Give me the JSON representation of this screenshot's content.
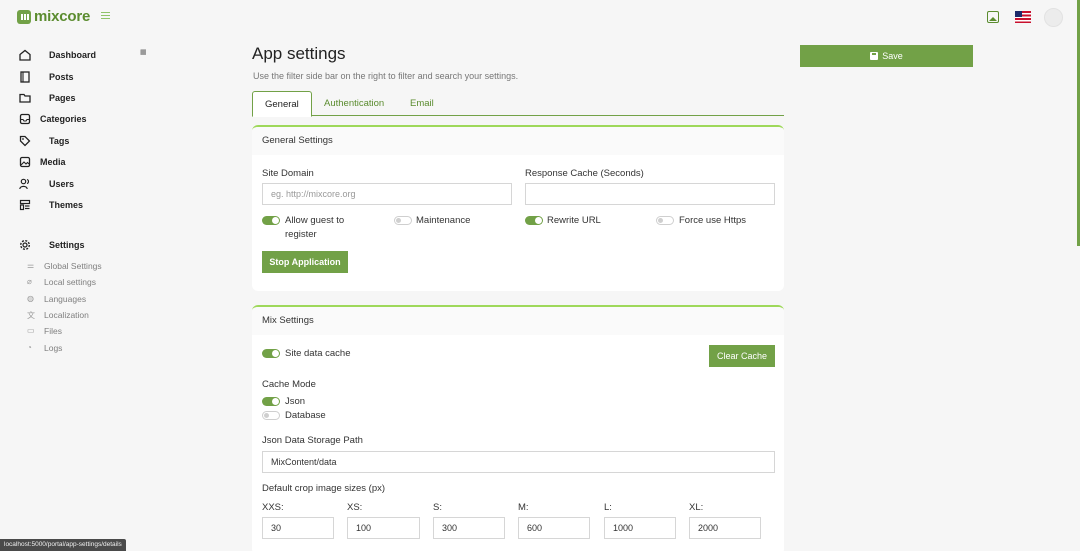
{
  "header": {
    "logo_text": "mixcore",
    "icons": [
      "menu-icon",
      "image-icon",
      "us-flag-icon",
      "avatar"
    ]
  },
  "sidebar": {
    "items": [
      {
        "label": "Dashboard",
        "icon": "home-icon"
      },
      {
        "label": "Posts",
        "icon": "document-icon"
      },
      {
        "label": "Pages",
        "icon": "folder-icon"
      },
      {
        "label": "Categories",
        "icon": "inbox-icon"
      },
      {
        "label": "Tags",
        "icon": "tag-icon"
      },
      {
        "label": "Media",
        "icon": "image-icon"
      },
      {
        "label": "Users",
        "icon": "users-icon"
      },
      {
        "label": "Themes",
        "icon": "layout-icon"
      },
      {
        "label": "Settings",
        "icon": "gear-icon"
      }
    ],
    "settings_sub": [
      {
        "label": "Global Settings",
        "icon": "sliders-icon"
      },
      {
        "label": "Local settings",
        "icon": "link-icon"
      },
      {
        "label": "Languages",
        "icon": "globe-icon"
      },
      {
        "label": "Localization",
        "icon": "translate-icon"
      },
      {
        "label": "Files",
        "icon": "file-icon"
      },
      {
        "label": "Logs",
        "icon": "clock-icon"
      }
    ]
  },
  "main": {
    "title": "App settings",
    "subtitle": "Use the filter side bar on the right to filter and search your settings.",
    "save_label": "Save",
    "tabs": [
      "General",
      "Authentication",
      "Email"
    ],
    "active_tab": "General"
  },
  "general": {
    "header": "General Settings",
    "site_domain_label": "Site Domain",
    "site_domain_placeholder": "eg. http://mixcore.org",
    "site_domain_value": "",
    "response_cache_label": "Response Cache (Seconds)",
    "response_cache_value": "",
    "toggles": [
      {
        "label_line1": "Allow guest to",
        "label_line2": "register",
        "on": true
      },
      {
        "label": "Maintenance",
        "on": false
      },
      {
        "label": "Rewrite URL",
        "on": true
      },
      {
        "label": "Force use Https",
        "on": false
      }
    ],
    "stop_button": "Stop Application"
  },
  "mix": {
    "header": "Mix Settings",
    "site_data_cache_label": "Site data cache",
    "site_data_cache_on": true,
    "clear_cache_button": "Clear Cache",
    "cache_mode_label": "Cache Mode",
    "cache_modes": [
      {
        "label": "Json",
        "on": true
      },
      {
        "label": "Database",
        "on": false
      }
    ],
    "json_path_label": "Json Data Storage Path",
    "json_path_value": "MixContent/data",
    "crop_label": "Default crop image sizes (px)",
    "crop_sizes": [
      {
        "label": "XXS:",
        "value": "30"
      },
      {
        "label": "XS:",
        "value": "100"
      },
      {
        "label": "S:",
        "value": "300"
      },
      {
        "label": "M:",
        "value": "600"
      },
      {
        "label": "L:",
        "value": "1000"
      },
      {
        "label": "XL:",
        "value": "2000"
      }
    ]
  },
  "status_bar": {
    "url": "localhost:5000/portal/app-settings/details"
  },
  "colors": {
    "accent": "#72a147",
    "accent_light": "#9ed85a",
    "brand_text": "#5b8c2f"
  }
}
